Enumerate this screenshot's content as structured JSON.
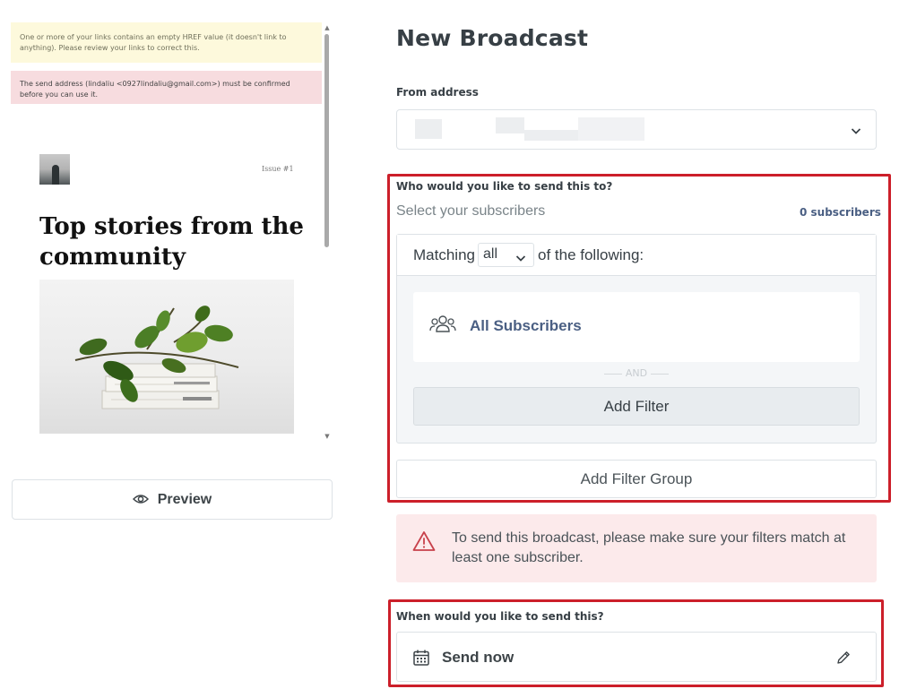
{
  "email_preview": {
    "notices": {
      "href_warning": "One or more of your links contains an empty HREF value (it doesn't link to anything). Please review your links to correct this.",
      "send_address_warning": "The send address (lindaliu <0927lindaliu@gmail.com>) must be confirmed before you can use it."
    },
    "issue_label": "Issue #1",
    "headline": "Top stories from the community"
  },
  "preview_button": {
    "label": "Preview",
    "icon": "eye-icon"
  },
  "page": {
    "title": "New Broadcast"
  },
  "from_address": {
    "label": "From address",
    "value_obscured": true
  },
  "recipients": {
    "question": "Who would you like to send this to?",
    "placeholder": "Select your subscribers",
    "count_label": "0 subscribers",
    "matching": {
      "prefix": "Matching",
      "selected": "all",
      "suffix": "of the following:"
    },
    "filter_card": {
      "label": "All Subscribers",
      "icon": "users-group-icon"
    },
    "and_divider": "AND",
    "add_filter_label": "Add Filter",
    "add_filter_group_label": "Add Filter Group"
  },
  "warning": {
    "icon": "warning-triangle-icon",
    "message": "To send this broadcast, please make sure your filters match at least one subscriber."
  },
  "schedule": {
    "question": "When would you like to send this?",
    "value": "Send now",
    "icon": "calendar-icon",
    "edit_icon": "pencil-icon"
  },
  "colors": {
    "highlight_border": "#cc1f2a",
    "accent_link": "#4a5f83",
    "warning_bg": "#fceaeb",
    "warning_icon": "#c8414b",
    "notice_yellow": "#fdf9dc",
    "notice_pink": "#f7dcdf"
  }
}
